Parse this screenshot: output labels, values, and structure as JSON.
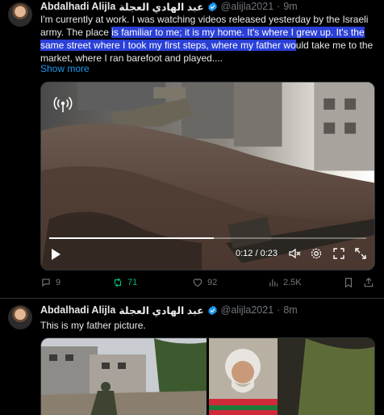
{
  "tweet1": {
    "author": {
      "name": "Abdalhadi Alijla",
      "arabic_name": "عبد الهادي العجلة",
      "handle": "@alijla2021",
      "time": "9m"
    },
    "text_before": "I'm currently at work. I was watching videos released yesterday by the Israeli army. The place ",
    "text_highlight": "is familiar to me; it is my home. It's where I grew up. It's the same street where I took my first steps, where my father wo",
    "text_after": "uld take me to the market, where I ran barefoot and played....",
    "show_more": "Show more",
    "video": {
      "elapsed": "0:12",
      "duration": "0:23",
      "progress": 0.52
    },
    "stats": {
      "replies": "9",
      "retweets": "71",
      "likes": "92",
      "views": "2.5K"
    }
  },
  "tweet2": {
    "author": {
      "name": "Abdalhadi Alijla",
      "arabic_name": "عبد الهادي العجلة",
      "handle": "@alijla2021",
      "time": "8m"
    },
    "text": "This is my father picture."
  },
  "icons": {
    "verified": "verified-badge-icon",
    "reply": "reply-icon",
    "retweet": "retweet-icon",
    "like": "heart-icon",
    "views": "views-chart-icon",
    "bookmark": "bookmark-icon",
    "share": "share-icon"
  },
  "colors": {
    "accent": "#1d9bf0",
    "retweet_active": "#00ba7c",
    "highlight": "#2a3fd6",
    "muted": "#71767b"
  }
}
